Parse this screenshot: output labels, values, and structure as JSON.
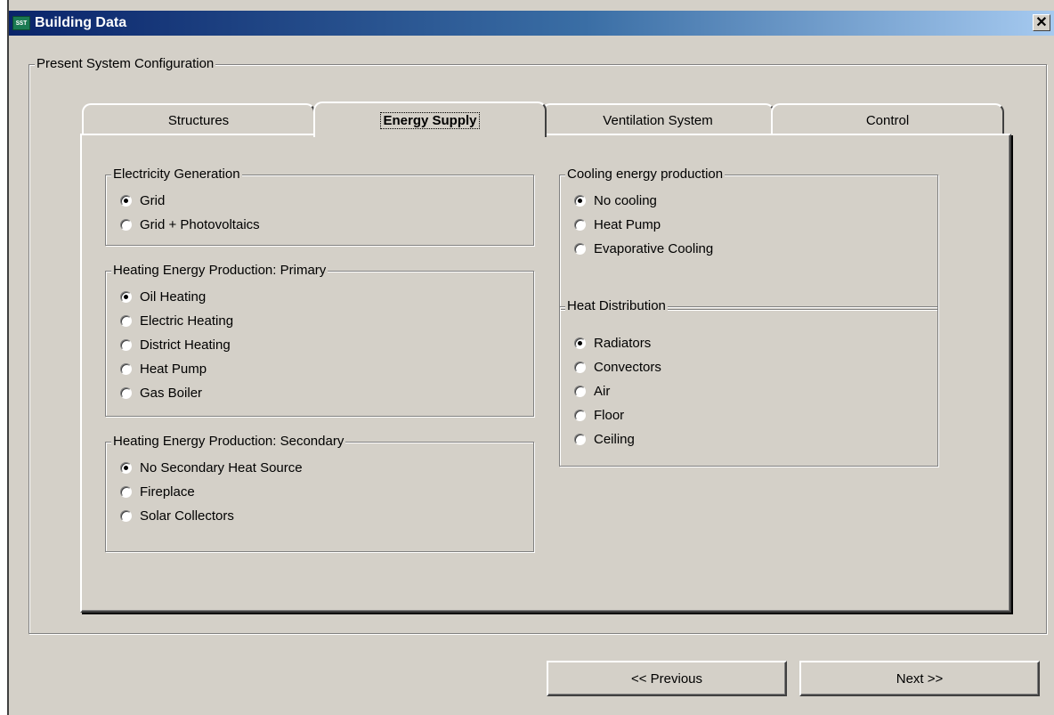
{
  "window": {
    "title": "Building Data",
    "icon_text": "SST",
    "close_glyph": "✕"
  },
  "outer_group": {
    "label": "Present System Configuration"
  },
  "tabs": [
    {
      "label": "Structures",
      "active": false
    },
    {
      "label": "Energy Supply",
      "active": true
    },
    {
      "label": "Ventilation System",
      "active": false
    },
    {
      "label": "Control",
      "active": false
    }
  ],
  "groups": {
    "electricity": {
      "label": "Electricity Generation",
      "options": [
        "Grid",
        "Grid + Photovoltaics"
      ],
      "selected": "Grid"
    },
    "heating_primary": {
      "label": "Heating Energy Production: Primary",
      "options": [
        "Oil Heating",
        "Electric Heating",
        "District Heating",
        "Heat Pump",
        "Gas Boiler"
      ],
      "selected": "Oil Heating"
    },
    "heating_secondary": {
      "label": "Heating Energy Production: Secondary",
      "options": [
        "No Secondary Heat Source",
        "Fireplace",
        "Solar Collectors"
      ],
      "selected": "No Secondary Heat Source"
    },
    "cooling": {
      "label": "Cooling energy production",
      "options": [
        "No cooling",
        "Heat Pump",
        "Evaporative Cooling"
      ],
      "selected": "No cooling"
    },
    "heat_distribution": {
      "label": "Heat Distribution",
      "options": [
        "Radiators",
        "Convectors",
        "Air",
        "Floor",
        "Ceiling"
      ],
      "selected": "Radiators"
    }
  },
  "buttons": {
    "previous": "<< Previous",
    "next": "Next >>"
  }
}
